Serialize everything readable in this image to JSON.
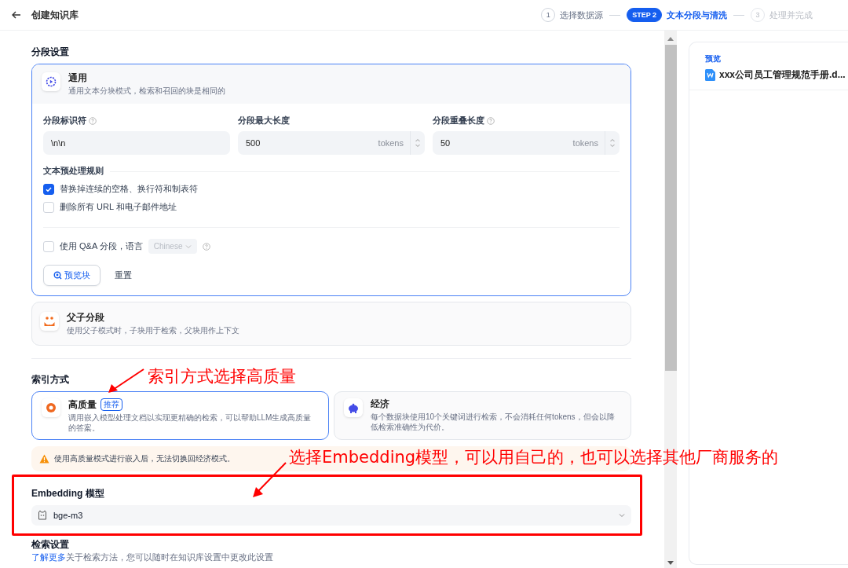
{
  "header": {
    "title": "创建知识库",
    "steps": [
      {
        "number": "1",
        "label": "选择数据源",
        "done": true,
        "selected": false
      },
      {
        "number": "STEP 2",
        "label": "文本分段与清洗",
        "done": false,
        "selected": true
      },
      {
        "number": "3",
        "label": "处理并完成",
        "done": false,
        "selected": false
      }
    ]
  },
  "segment_settings": {
    "title": "分段设置",
    "modes": [
      {
        "kind": "general",
        "name": "通用",
        "description": "通用文本分块模式，检索和召回的块是相同的",
        "selected": true
      },
      {
        "kind": "parent_child",
        "name": "父子分段",
        "description": "使用父子模式时，子块用于检索，父块用作上下文",
        "selected": false
      }
    ],
    "fields": [
      {
        "label": "分段标识符",
        "help": true,
        "value": "\\n\\n"
      },
      {
        "label": "分段最大长度",
        "help": false,
        "value": "500",
        "unit": "tokens"
      },
      {
        "label": "分段重叠长度",
        "help": true,
        "value": "50",
        "unit": "tokens"
      }
    ],
    "rules_title": "文本预处理规则",
    "rules": [
      {
        "label": "替换掉连续的空格、换行符和制表符",
        "checked": true
      },
      {
        "label": "删除所有 URL 和电子邮件地址",
        "checked": false
      }
    ],
    "qa": {
      "label": "使用 Q&A 分段，语言",
      "checked": false,
      "language": "Chinese"
    },
    "buttons": [
      {
        "kind": "preview",
        "label": "预览块"
      },
      {
        "kind": "reset",
        "label": "重置"
      }
    ]
  },
  "index_method": {
    "title": "索引方式",
    "options": [
      {
        "kind": "high_quality",
        "name": "高质量",
        "badge": "推荐",
        "description": "调用嵌入模型处理文档以实现更精确的检索，可以帮助LLM生成高质量的答案。",
        "selected": true
      },
      {
        "kind": "economy",
        "name": "经济",
        "description": "每个数据块使用10个关键词进行检索，不会消耗任何tokens，但会以降低检索准确性为代价。",
        "selected": false
      }
    ],
    "warning": "使用高质量模式进行嵌入后，无法切换回经济模式。"
  },
  "embedding": {
    "label": "Embedding 模型",
    "model": "bge-m3"
  },
  "retrieval": {
    "title": "检索设置",
    "link": "了解更多",
    "description": "关于检索方法，您可以随时在知识库设置中更改此设置"
  },
  "preview": {
    "label": "预览",
    "file": "xxx公司员工管理规范手册.d..."
  },
  "annotations": [
    {
      "text": "索引方式选择高质量"
    },
    {
      "text": "选择Embedding模型，可以用自己的，也可以选择其他厂商服务的"
    }
  ]
}
